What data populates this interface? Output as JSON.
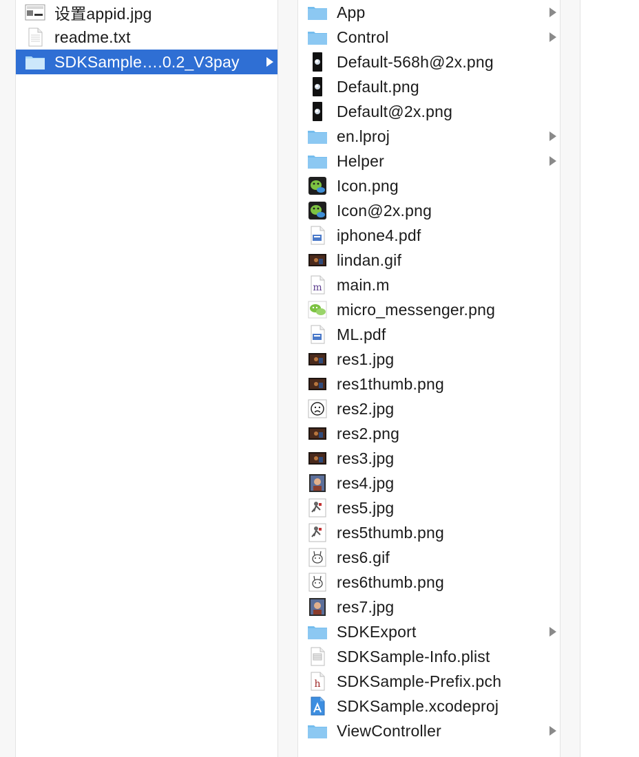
{
  "columns": {
    "left": {
      "items": [
        {
          "name": "设置appid.jpg",
          "icon": "image-icon",
          "selected": false,
          "has_children": false
        },
        {
          "name": "readme.txt",
          "icon": "text-file-icon",
          "selected": false,
          "has_children": false
        },
        {
          "name": "SDKSample….0.2_V3pay",
          "icon": "folder-icon",
          "selected": true,
          "has_children": true
        }
      ]
    },
    "middle": {
      "items": [
        {
          "name": "App",
          "icon": "folder-icon",
          "has_children": true
        },
        {
          "name": "Control",
          "icon": "folder-icon",
          "has_children": true
        },
        {
          "name": "Default-568h@2x.png",
          "icon": "phone-image-icon",
          "has_children": false
        },
        {
          "name": "Default.png",
          "icon": "phone-image-icon",
          "has_children": false
        },
        {
          "name": "Default@2x.png",
          "icon": "phone-image-icon",
          "has_children": false
        },
        {
          "name": "en.lproj",
          "icon": "folder-icon",
          "has_children": true
        },
        {
          "name": "Helper",
          "icon": "folder-icon",
          "has_children": true
        },
        {
          "name": "Icon.png",
          "icon": "wechat-app-icon",
          "has_children": false
        },
        {
          "name": "Icon@2x.png",
          "icon": "wechat-app-icon",
          "has_children": false
        },
        {
          "name": "iphone4.pdf",
          "icon": "pdf-file-icon",
          "has_children": false
        },
        {
          "name": "lindan.gif",
          "icon": "photo-thumbnail-icon",
          "has_children": false
        },
        {
          "name": "main.m",
          "icon": "objc-source-icon",
          "has_children": false
        },
        {
          "name": "micro_messenger.png",
          "icon": "wechat-logo-icon",
          "has_children": false
        },
        {
          "name": "ML.pdf",
          "icon": "pdf-file-icon",
          "has_children": false
        },
        {
          "name": "res1.jpg",
          "icon": "photo-thumbnail-icon",
          "has_children": false
        },
        {
          "name": "res1thumb.png",
          "icon": "photo-thumbnail-icon",
          "has_children": false
        },
        {
          "name": "res2.jpg",
          "icon": "sad-face-image-icon",
          "has_children": false
        },
        {
          "name": "res2.png",
          "icon": "photo-thumbnail-icon",
          "has_children": false
        },
        {
          "name": "res3.jpg",
          "icon": "photo-thumbnail-icon",
          "has_children": false
        },
        {
          "name": "res4.jpg",
          "icon": "portrait-thumbnail-icon",
          "has_children": false
        },
        {
          "name": "res5.jpg",
          "icon": "figure-thumbnail-icon",
          "has_children": false
        },
        {
          "name": "res5thumb.png",
          "icon": "figure-thumbnail-icon",
          "has_children": false
        },
        {
          "name": "res6.gif",
          "icon": "cartoon-thumbnail-icon",
          "has_children": false
        },
        {
          "name": "res6thumb.png",
          "icon": "cartoon-thumbnail-icon",
          "has_children": false
        },
        {
          "name": "res7.jpg",
          "icon": "portrait-thumbnail-icon",
          "has_children": false
        },
        {
          "name": "SDKExport",
          "icon": "folder-icon",
          "has_children": true
        },
        {
          "name": "SDKSample-Info.plist",
          "icon": "plist-file-icon",
          "has_children": false
        },
        {
          "name": "SDKSample-Prefix.pch",
          "icon": "header-file-icon",
          "has_children": false
        },
        {
          "name": "SDKSample.xcodeproj",
          "icon": "xcodeproj-icon",
          "has_children": false
        },
        {
          "name": "ViewController",
          "icon": "folder-icon",
          "has_children": true
        }
      ]
    }
  },
  "colors": {
    "selection": "#2f6fd4",
    "folder": "#8cc8f2",
    "text": "#1b1b1b",
    "chevron": "#8a8a8a"
  }
}
